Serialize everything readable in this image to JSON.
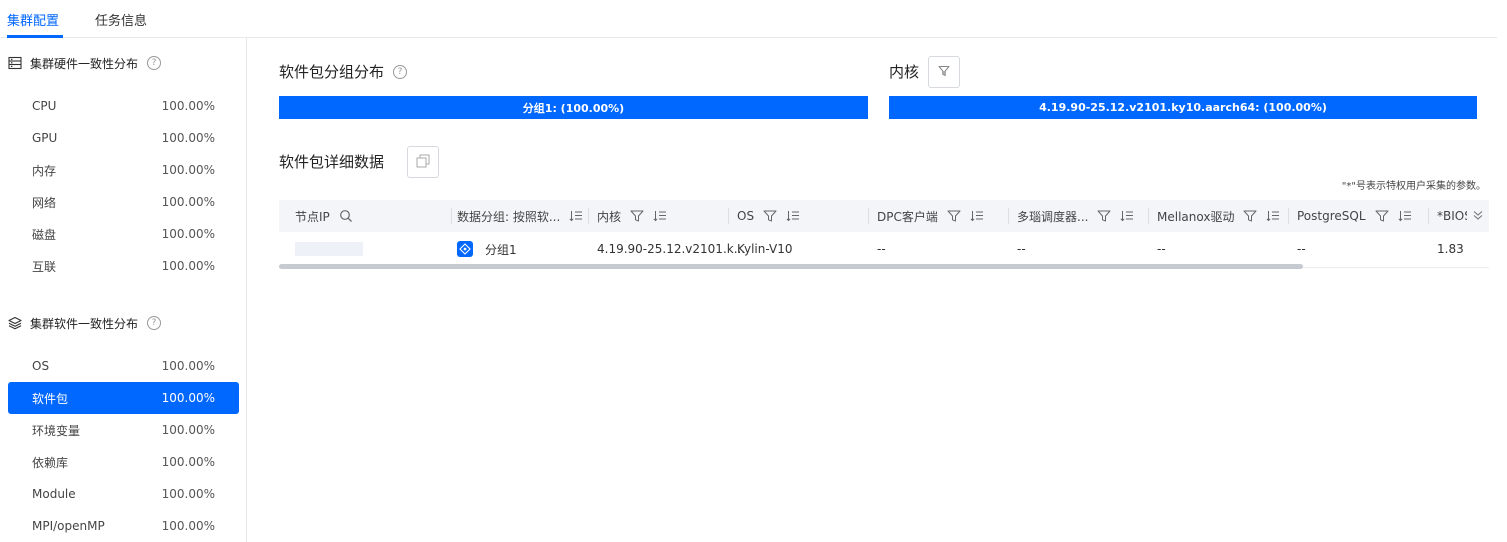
{
  "tabs": [
    {
      "label": "集群配置",
      "active": true
    },
    {
      "label": "任务信息",
      "active": false
    }
  ],
  "sidebar": {
    "hardware": {
      "title": "集群硬件一致性分布",
      "icon": "server-icon",
      "items": [
        {
          "label": "CPU",
          "value": "100.00%"
        },
        {
          "label": "GPU",
          "value": "100.00%"
        },
        {
          "label": "内存",
          "value": "100.00%"
        },
        {
          "label": "网络",
          "value": "100.00%"
        },
        {
          "label": "磁盘",
          "value": "100.00%"
        },
        {
          "label": "互联",
          "value": "100.00%"
        }
      ]
    },
    "software": {
      "title": "集群软件一致性分布",
      "icon": "layers-icon",
      "items": [
        {
          "label": "OS",
          "value": "100.00%"
        },
        {
          "label": "软件包",
          "value": "100.00%",
          "active": true
        },
        {
          "label": "环境变量",
          "value": "100.00%"
        },
        {
          "label": "依赖库",
          "value": "100.00%"
        },
        {
          "label": "Module",
          "value": "100.00%"
        },
        {
          "label": "MPI/openMP",
          "value": "100.00%"
        }
      ]
    }
  },
  "main": {
    "group_dist": {
      "title": "软件包分组分布",
      "bar_label": "分组1: (100.00%)",
      "bar_fraction": 1.0
    },
    "kernel": {
      "title": "内核",
      "bar_label": "4.19.90-25.12.v2101.ky10.aarch64: (100.00%)",
      "bar_fraction": 1.0
    },
    "detail": {
      "title": "软件包详细数据",
      "note": "\"*\"号表示特权用户采集的参数。"
    },
    "table": {
      "columns": [
        "节点IP",
        "数据分组: 按照软...",
        "内核",
        "OS",
        "DPC客户端",
        "多瑙调度器...",
        "Mellanox驱动",
        "PostgreSQL",
        "*BIOS"
      ],
      "rows": [
        [
          "",
          "分组1",
          "4.19.90-25.12.v2101.k...",
          "Kylin-V10",
          "--",
          "--",
          "--",
          "--",
          "1.83"
        ]
      ],
      "scroll_fraction": 0.85
    }
  },
  "colors": {
    "accent": "#0067ff",
    "header_bg": "#f3f5f8"
  }
}
